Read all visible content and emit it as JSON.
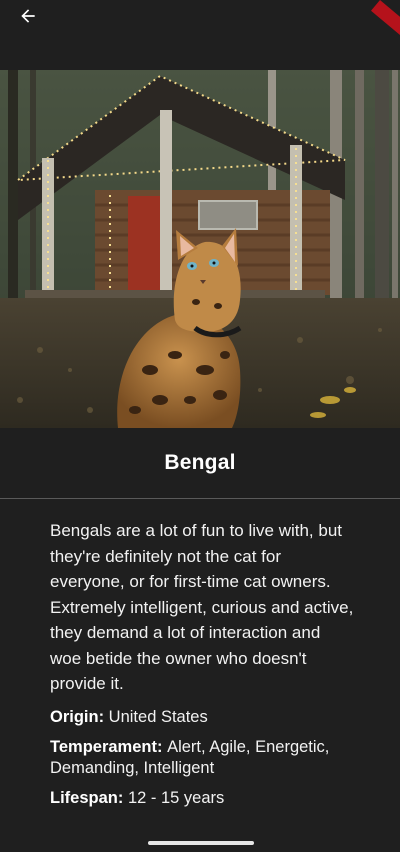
{
  "app_bar": {
    "back_icon": "arrow-left-icon"
  },
  "hero_image": {
    "subject": "bengal-cat-photo"
  },
  "breed": {
    "name": "Bengal",
    "description": "Bengals are a lot of fun to live with, but they're definitely not the cat for everyone, or for first-time cat owners. Extremely intelligent, curious and active, they demand a lot of interaction and woe betide the owner who doesn't provide it.",
    "origin_label": "Origin:",
    "origin": "United States",
    "temperament_label": "Temperament:",
    "temperament": "Alert, Agile, Energetic, Demanding, Intelligent",
    "lifespan_label": "Lifespan:",
    "lifespan": "12 - 15 years"
  },
  "colors": {
    "background": "#1f1f1f",
    "text": "#ffffff",
    "divider": "#5a5a5a",
    "debug_banner": "#b5121b"
  }
}
